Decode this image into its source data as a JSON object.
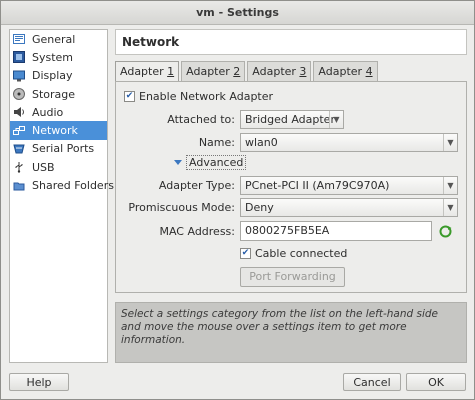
{
  "window": {
    "title": "vm - Settings"
  },
  "sidebar": {
    "items": [
      {
        "label": "General",
        "icon": "general-icon"
      },
      {
        "label": "System",
        "icon": "system-icon"
      },
      {
        "label": "Display",
        "icon": "display-icon"
      },
      {
        "label": "Storage",
        "icon": "storage-icon"
      },
      {
        "label": "Audio",
        "icon": "audio-icon"
      },
      {
        "label": "Network",
        "icon": "network-icon",
        "active": true
      },
      {
        "label": "Serial Ports",
        "icon": "serial-ports-icon"
      },
      {
        "label": "USB",
        "icon": "usb-icon"
      },
      {
        "label": "Shared Folders",
        "icon": "shared-folders-icon"
      }
    ]
  },
  "page": {
    "title": "Network"
  },
  "tabs": [
    {
      "prefix": "Adapter ",
      "num": "1"
    },
    {
      "prefix": "Adapter ",
      "num": "2"
    },
    {
      "prefix": "Adapter ",
      "num": "3"
    },
    {
      "prefix": "Adapter ",
      "num": "4"
    }
  ],
  "adapter": {
    "enable_label": "Enable Network Adapter",
    "enable_checked": true,
    "attached_label": "Attached to:",
    "attached_value": "Bridged Adapter",
    "name_label": "Name:",
    "name_value": "wlan0",
    "advanced_label": "Advanced",
    "adapter_type_label": "Adapter Type:",
    "adapter_type_value": "PCnet-PCI II (Am79C970A)",
    "promiscuous_label": "Promiscuous Mode:",
    "promiscuous_value": "Deny",
    "mac_label": "MAC Address:",
    "mac_value": "0800275FB5EA",
    "cable_label": "Cable connected",
    "cable_checked": true,
    "port_forwarding_label": "Port Forwarding"
  },
  "info": {
    "text": "Select a settings category from the list on the left-hand side and move the mouse over a settings item to get more information."
  },
  "footer": {
    "help_label": "Help",
    "cancel_label": "Cancel",
    "ok_label": "OK"
  },
  "colors": {
    "selection": "#4a90d9",
    "info_bg": "#c6c6c3",
    "accent_check": "#2a5fa8",
    "refresh_green": "#3a9a2a"
  }
}
